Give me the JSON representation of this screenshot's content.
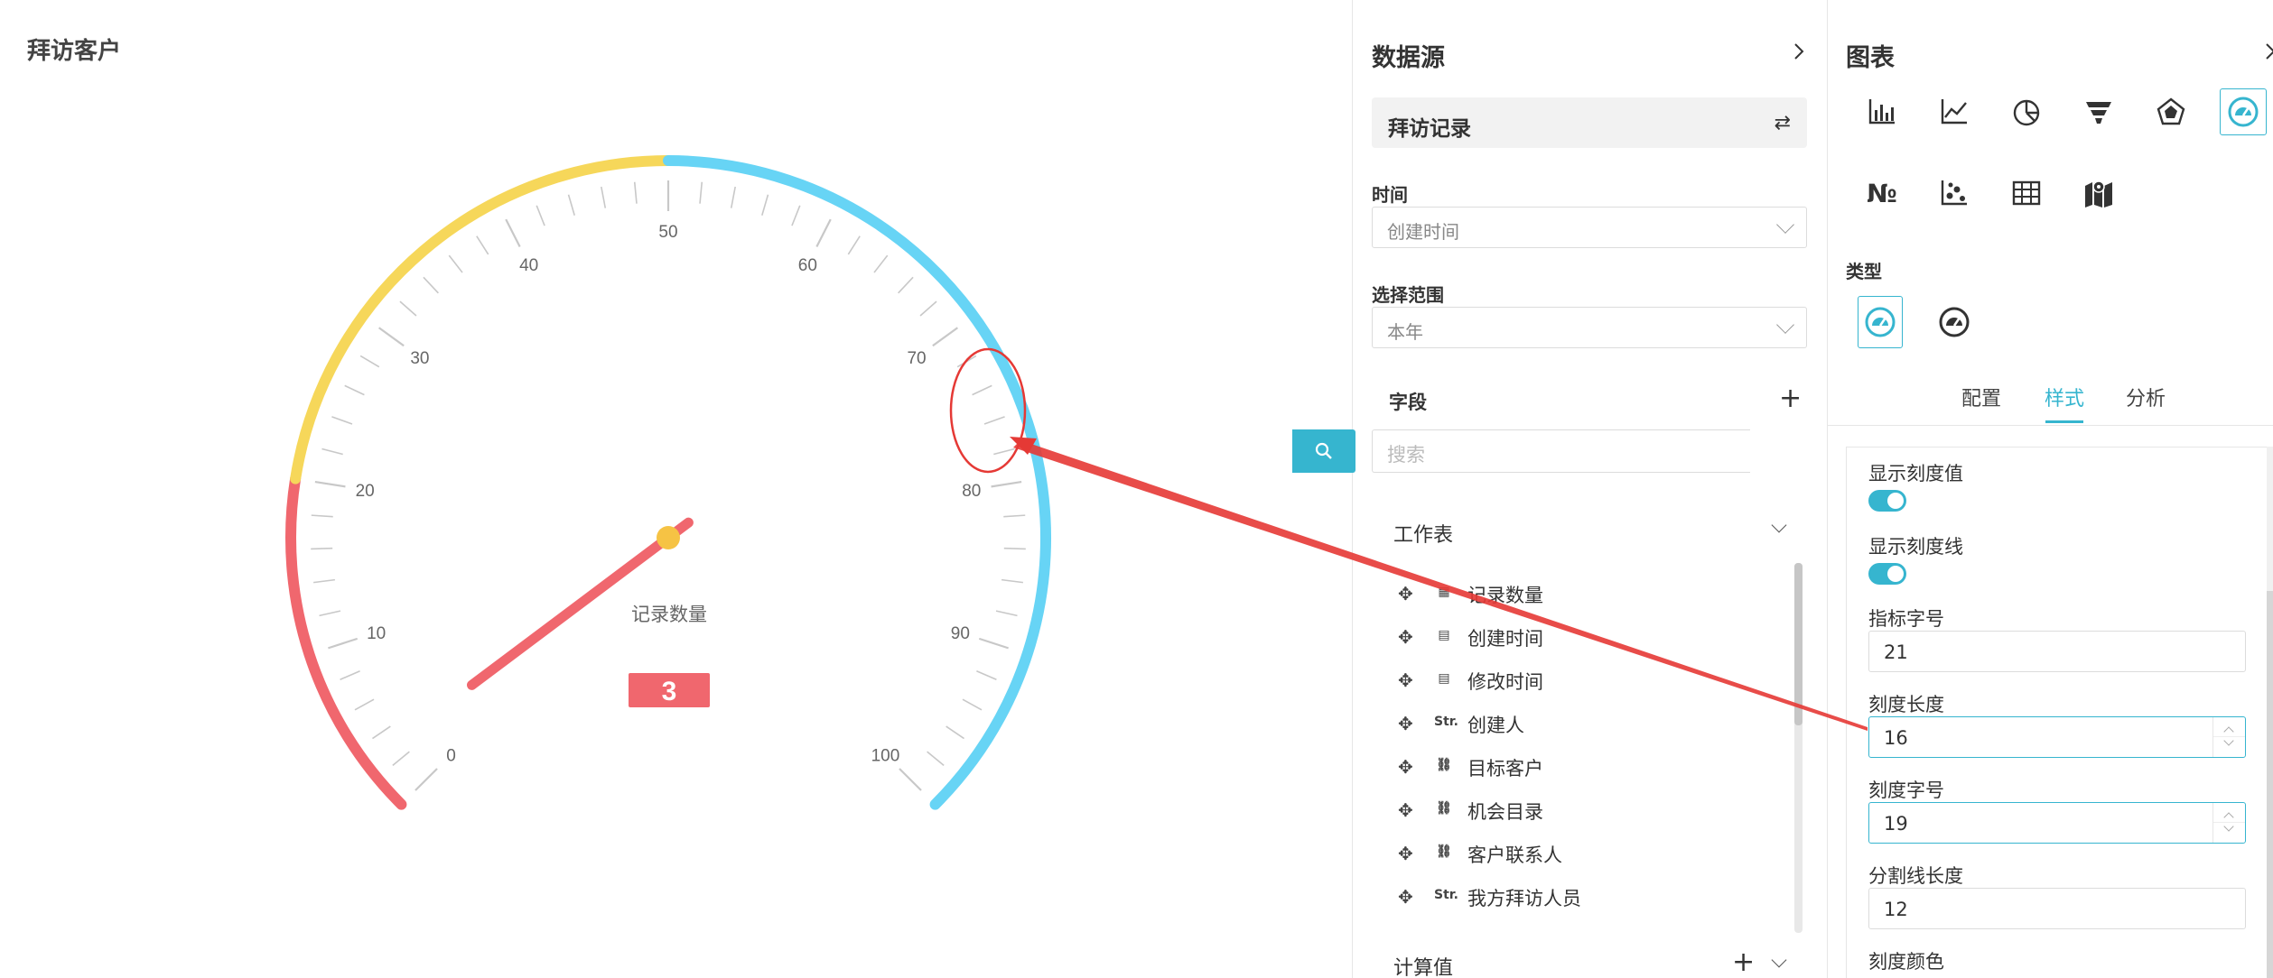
{
  "canvas": {
    "title": "拜访客户",
    "gauge": {
      "value": 3,
      "value_label": "记录数量",
      "min": 0,
      "max": 100,
      "tick_labels": [
        "0",
        "10",
        "20",
        "30",
        "40",
        "50",
        "60",
        "70",
        "80",
        "90",
        "100"
      ],
      "band_colors": [
        "#f0676e",
        "#f6d75a",
        "#67d4f5"
      ],
      "bands": [
        {
          "from": 0,
          "to": 20,
          "color": "#f0676e"
        },
        {
          "from": 20,
          "to": 50,
          "color": "#f6d75a"
        },
        {
          "from": 50,
          "to": 100,
          "color": "#67d4f5"
        }
      ],
      "pointer_color": "#f0676e",
      "pivot_color": "#f6c344"
    }
  },
  "datasource": {
    "title": "数据源",
    "source_name": "拜访记录",
    "time_label": "时间",
    "time_value": "创建时间",
    "range_label": "选择范围",
    "range_value": "本年",
    "fields_label": "字段",
    "search_placeholder": "搜索",
    "worksheet_label": "工作表",
    "fields": [
      {
        "icon": "calculator-icon",
        "glyph": "▦",
        "name": "记录数量"
      },
      {
        "icon": "calendar-icon",
        "glyph": "▤",
        "name": "创建时间"
      },
      {
        "icon": "calendar-icon",
        "glyph": "▤",
        "name": "修改时间"
      },
      {
        "icon": "string-icon",
        "glyph": "Str.",
        "name": "创建人"
      },
      {
        "icon": "link-icon",
        "glyph": "⛓",
        "name": "目标客户"
      },
      {
        "icon": "link-icon",
        "glyph": "⛓",
        "name": "机会目录"
      },
      {
        "icon": "link-icon",
        "glyph": "⛓",
        "name": "客户联系人"
      },
      {
        "icon": "string-icon",
        "glyph": "Str.",
        "name": "我方拜访人员"
      }
    ],
    "computed_label": "计算值"
  },
  "chart_panel": {
    "title": "图表",
    "chart_types": [
      "bar-chart-icon",
      "line-chart-icon",
      "pie-chart-icon",
      "funnel-chart-icon",
      "radar-chart-icon",
      "gauge-chart-icon",
      "number-icon",
      "scatter-chart-icon",
      "table-icon",
      "map-icon"
    ],
    "number_icon_text": "№",
    "type_label": "类型",
    "tabs": [
      "配置",
      "样式",
      "分析"
    ],
    "active_tab": "样式",
    "options": {
      "show_tick_values_label": "显示刻度值",
      "show_tick_lines_label": "显示刻度线",
      "indicator_font_label": "指标字号",
      "indicator_font_value": "21",
      "tick_length_label": "刻度长度",
      "tick_length_value": "16",
      "tick_font_label": "刻度字号",
      "tick_font_value": "19",
      "split_length_label": "分割线长度",
      "split_length_value": "12",
      "tick_color_label": "刻度颜色"
    },
    "accent": "#36b5cf"
  }
}
